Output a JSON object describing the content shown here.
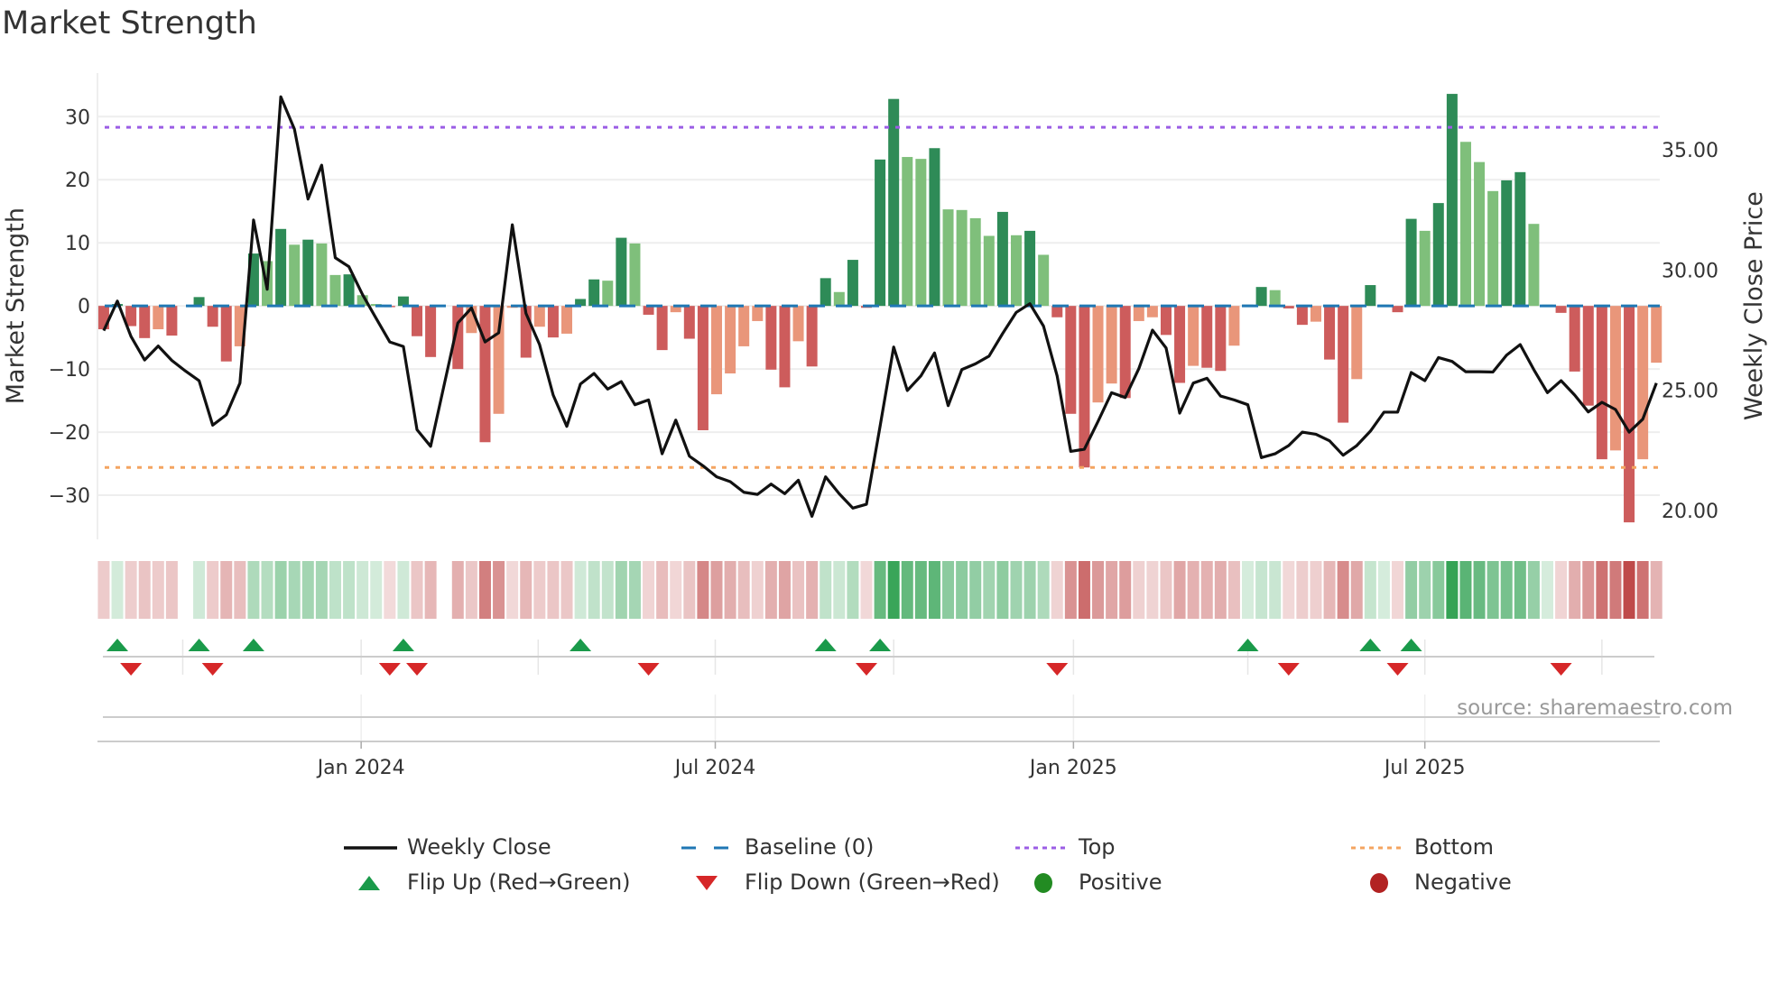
{
  "title": "Market Strength",
  "source": "source: sharemaestro.com",
  "legend": [
    {
      "label": "Weekly Close",
      "kind": "line",
      "color": "#111111"
    },
    {
      "label": "Baseline (0)",
      "kind": "dash",
      "color": "#1f77b4"
    },
    {
      "label": "Top",
      "kind": "dot",
      "color": "#9b5de5"
    },
    {
      "label": "Bottom",
      "kind": "dot",
      "color": "#f4a460"
    },
    {
      "label": "Flip Up (Red→Green)",
      "kind": "tri-up",
      "color": "#1a9a4a"
    },
    {
      "label": "Flip Down (Green→Red)",
      "kind": "tri-down",
      "color": "#d62728"
    },
    {
      "label": "Positive",
      "kind": "circle",
      "color": "#228b22"
    },
    {
      "label": "Negative",
      "kind": "circle",
      "color": "#b22222"
    }
  ],
  "colors": {
    "pos_strong": "#2e8b57",
    "pos_weak": "#7fbf7b",
    "neg_strong": "#cd5c5c",
    "neg_weak": "#e9967a"
  },
  "chart_data": {
    "type": "bar",
    "title": "Market Strength",
    "ylabel": "Market Strength",
    "y2label": "Weekly Close Price",
    "ylim": [
      -37,
      36.9
    ],
    "y2lim": [
      18.8,
      38.19
    ],
    "xlim": [
      -0.46,
      114.25
    ],
    "yticks": [
      30,
      20,
      10,
      0,
      -10,
      -20,
      -30
    ],
    "yticklabels": [
      "30",
      "20",
      "10",
      "0",
      "−10",
      "−20",
      "−30"
    ],
    "y2ticks": [
      35,
      30,
      25,
      20
    ],
    "y2ticklabels": [
      "35.00",
      "30.00",
      "25.00",
      "20.00"
    ],
    "xticks": [
      18.9,
      44.9,
      71.2,
      97.0
    ],
    "xticklabels": [
      "Jan 2024",
      "Jul 2024",
      "Jan 2025",
      "Jul 2025"
    ],
    "quarter_lines": [
      5.8,
      18.9,
      31.9,
      44.9,
      58.0,
      71.2,
      84.0,
      97.0,
      110.0
    ],
    "top_level": 28.3,
    "bottom_level": -25.6,
    "baseline": 0,
    "strength": [
      -3.7,
      0.3,
      -3.2,
      -5.1,
      -3.7,
      -4.7,
      null,
      1.4,
      -3.3,
      -8.8,
      -6.4,
      8.3,
      7.1,
      12.2,
      9.7,
      10.5,
      9.9,
      4.9,
      5.0,
      1.7,
      0.3,
      -0.2,
      1.5,
      -4.8,
      -8.1,
      null,
      -10.0,
      -4.3,
      -21.6,
      -17.1,
      -0.3,
      -8.2,
      -3.3,
      -5.0,
      -4.4,
      1.1,
      4.2,
      4.0,
      10.8,
      9.9,
      -1.4,
      -7.0,
      -1.0,
      -5.2,
      -19.7,
      -14.0,
      -10.7,
      -6.4,
      -2.4,
      -10.1,
      -12.9,
      -5.6,
      -9.6,
      4.4,
      2.2,
      7.3,
      -0.3,
      23.2,
      32.8,
      23.6,
      23.3,
      25.0,
      15.3,
      15.2,
      13.9,
      11.1,
      14.9,
      11.2,
      11.9,
      8.1,
      -1.8,
      -17.1,
      -25.6,
      -15.3,
      -12.3,
      -14.6,
      -2.4,
      -1.8,
      -4.6,
      -12.2,
      -9.5,
      -9.8,
      -10.3,
      -6.3,
      0.2,
      3.0,
      2.5,
      -0.4,
      -3.0,
      -2.5,
      -8.5,
      -18.5,
      -11.6,
      3.3,
      0.2,
      -1.0,
      13.8,
      11.9,
      16.3,
      33.6,
      26.0,
      22.8,
      18.2,
      19.9,
      21.2,
      13.0,
      0.2,
      -1.1,
      -10.4,
      -15.8,
      -24.3,
      -22.9,
      -34.3,
      -24.3,
      -9.0
    ],
    "close": [
      27.48,
      28.71,
      27.24,
      26.26,
      26.84,
      26.24,
      25.8,
      25.4,
      23.55,
      23.98,
      25.3,
      32.08,
      29.2,
      37.2,
      35.86,
      32.95,
      34.36,
      30.51,
      30.14,
      28.98,
      27.99,
      27.01,
      26.82,
      23.36,
      22.67,
      25.24,
      27.8,
      28.42,
      27.01,
      27.39,
      31.88,
      28.2,
      26.9,
      24.8,
      23.5,
      25.26,
      25.7,
      25.05,
      25.36,
      24.4,
      24.6,
      22.36,
      23.76,
      22.26,
      21.86,
      21.4,
      21.2,
      20.76,
      20.67,
      21.1,
      20.7,
      21.26,
      19.76,
      21.4,
      20.7,
      20.1,
      20.26,
      23.5,
      26.8,
      24.99,
      25.6,
      26.55,
      24.36,
      25.86,
      26.1,
      26.42,
      27.36,
      28.24,
      28.6,
      27.67,
      25.6,
      22.46,
      22.55,
      23.7,
      24.9,
      24.7,
      25.9,
      27.5,
      26.76,
      24.05,
      25.3,
      25.5,
      24.76,
      24.6,
      24.4,
      22.2,
      22.36,
      22.7,
      23.26,
      23.17,
      22.9,
      22.3,
      22.7,
      23.3,
      24.09,
      24.09,
      25.74,
      25.4,
      26.36,
      26.2,
      25.77,
      25.77,
      25.76,
      26.46,
      26.9,
      25.86,
      24.9,
      25.4,
      24.8,
      24.1,
      24.5,
      24.2,
      23.26,
      23.8,
      25.3
    ],
    "flip_up": [
      1,
      7,
      11,
      22,
      35,
      53,
      57,
      84,
      93,
      96
    ],
    "flip_down": [
      2,
      8,
      21,
      23,
      40,
      56,
      70,
      87,
      95,
      107
    ]
  }
}
